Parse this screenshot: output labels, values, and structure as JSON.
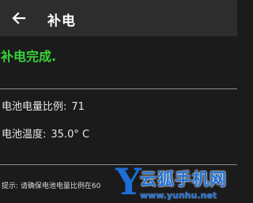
{
  "app_bar": {
    "title": "补电",
    "back_icon": "arrow-back-icon"
  },
  "status": {
    "text": "补电完成.",
    "color": "#38d238"
  },
  "battery_info": {
    "level_label": "电池电量比例:",
    "level_value": "71",
    "temperature_label": "电池温度:",
    "temperature_value": "35.0° C"
  },
  "tip": {
    "text": "提示: 请确保电池电量比例在60"
  },
  "watermark": {
    "logo": "Y",
    "name": "云狐手机网",
    "url": "www.yunhu.net",
    "color": "#1d6fd6"
  }
}
